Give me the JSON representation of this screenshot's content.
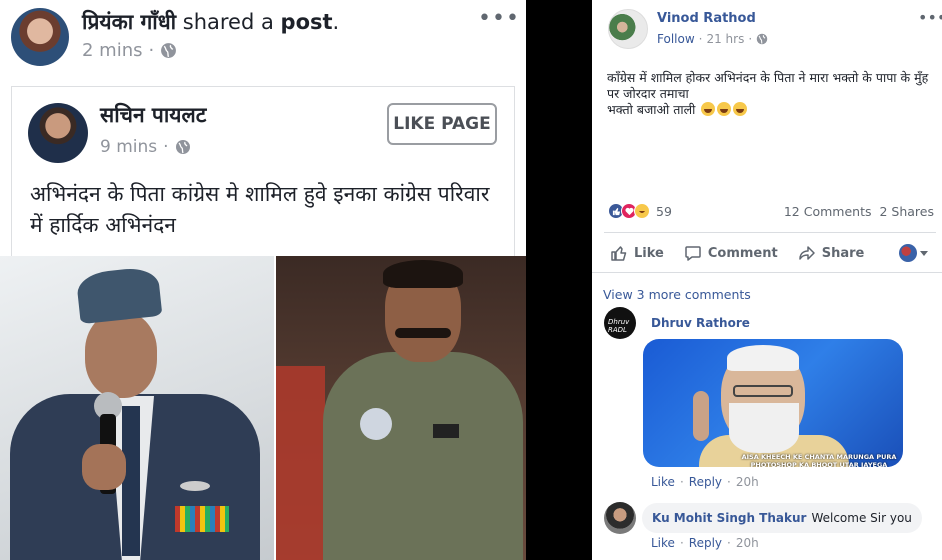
{
  "left_post": {
    "sharer_name": "प्रियंका गाँधी",
    "shared_verb": "shared a",
    "shared_object": "post",
    "shared_period": ".",
    "time": "2 mins",
    "dot": "·",
    "more": "•••",
    "card": {
      "page_name": "सचिन पायलट",
      "time": "9 mins",
      "dot": "·",
      "like_page_label": "LIKE PAGE",
      "text": "अभिनंदन के पिता कांग्रेस मे शामिल हुवे इनका कांग्रेस परिवार में हार्दिक अभिनंदन"
    }
  },
  "right_post": {
    "author": "Vinod Rathod",
    "follow": "Follow",
    "dot": "·",
    "time": "21 hrs",
    "more": "•••",
    "text_line1": "कॉंग्रेस में शामिल होकर अभिनंदन के पिता ने मारा भक्तो के पापा के मुँह पर जोरदार तमाचा",
    "text_line2": "भक्तो बजाओ ताली",
    "reaction_count": "59",
    "comments_count": "12 Comments",
    "shares_count": "2 Shares",
    "actions": {
      "like": "Like",
      "comment": "Comment",
      "share": "Share"
    },
    "view_more_comments": "View 3 more comments",
    "comments": [
      {
        "author": "Dhruv Rathore",
        "avatar_text": "Dhruv RADL",
        "meme_caption": "AISA KHEECH KE CHANTA MARUNGA PURA PHOTOSHOP KA BHOOT UTAR JAYEGA",
        "like": "Like",
        "reply": "Reply",
        "dot": "·",
        "time": "20h"
      },
      {
        "author": "Ku Mohit Singh Thakur",
        "text": "Welcome Sir you",
        "like": "Like",
        "reply": "Reply",
        "dot": "·",
        "time": "20h"
      }
    ]
  },
  "colors": {
    "link_blue": "#385898",
    "meta_gray": "#90949c",
    "text_dark": "#1d2129",
    "divider": "#dadde1"
  },
  "icons": [
    "globe-icon",
    "more-icon",
    "like-reaction-icon",
    "love-reaction-icon",
    "haha-reaction-icon",
    "thumbs-up-icon",
    "comment-icon",
    "share-icon",
    "chevron-down-icon"
  ]
}
